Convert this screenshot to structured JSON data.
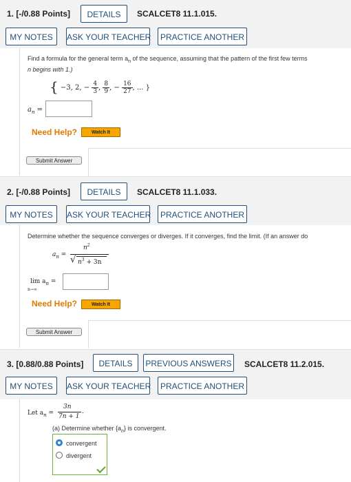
{
  "q1": {
    "label": "1. [-/0.88 Points]",
    "details": "DETAILS",
    "code": "SCALCET8 11.1.015.",
    "buttons": [
      "MY NOTES",
      "ASK YOUR TEACHER",
      "PRACTICE ANOTHER"
    ],
    "prompt_1": "Find a formula for the general term a",
    "prompt_sub": "n",
    "prompt_2": " of the sequence, assuming that the pattern of the first few terms",
    "prompt_3": "n begins with 1.)",
    "seq_open": "{",
    "seq_a": "−3, 2, −",
    "f1_num": "4",
    "f1_den": "3",
    "f2_num": "8",
    "f2_den": "9",
    "seq_mid": ", −",
    "f3_num": "16",
    "f3_den": "27",
    "seq_end": ", ... }",
    "answer_label": "a",
    "answer_sub": "n",
    "answer_eq": " =",
    "need_help": "Need Help?",
    "watch": "Watch It",
    "submit": "Submit Answer"
  },
  "q2": {
    "label": "2. [-/0.88 Points]",
    "details": "DETAILS",
    "code": "SCALCET8 11.1.033.",
    "buttons": [
      "MY NOTES",
      "ASK YOUR TEACHER",
      "PRACTICE ANOTHER"
    ],
    "prompt": "Determine whether the sequence converges or diverges. If it converges, find the limit. (If an answer do",
    "an_label": "a",
    "an_sub": "n",
    "eq": " =",
    "num": "n",
    "num_exp": "2",
    "den_1": "n",
    "den_exp": "3",
    "den_2": " + 3n",
    "lim_label": "lim  a",
    "lim_sub": "n",
    "lim_eq": " =",
    "lim_under": "n→∞",
    "need_help": "Need Help?",
    "watch": "Watch It",
    "submit": "Submit Answer"
  },
  "q3": {
    "label": "3. [0.88/0.88 Points]",
    "details": "DETAILS",
    "prev": "PREVIOUS ANSWERS",
    "code": "SCALCET8 11.2.015.",
    "buttons": [
      "MY NOTES",
      "ASK YOUR TEACHER",
      "PRACTICE ANOTHER"
    ],
    "let": "Let a",
    "let_sub": "n",
    "let_eq": " =",
    "num": "3n",
    "den": "7n + 1",
    "let_dot": ".",
    "part_a": "(a) Determine whether {a",
    "part_a_sub": "n",
    "part_a_end": "} is convergent.",
    "options": [
      "convergent",
      "divergent"
    ],
    "selected": "convergent"
  }
}
